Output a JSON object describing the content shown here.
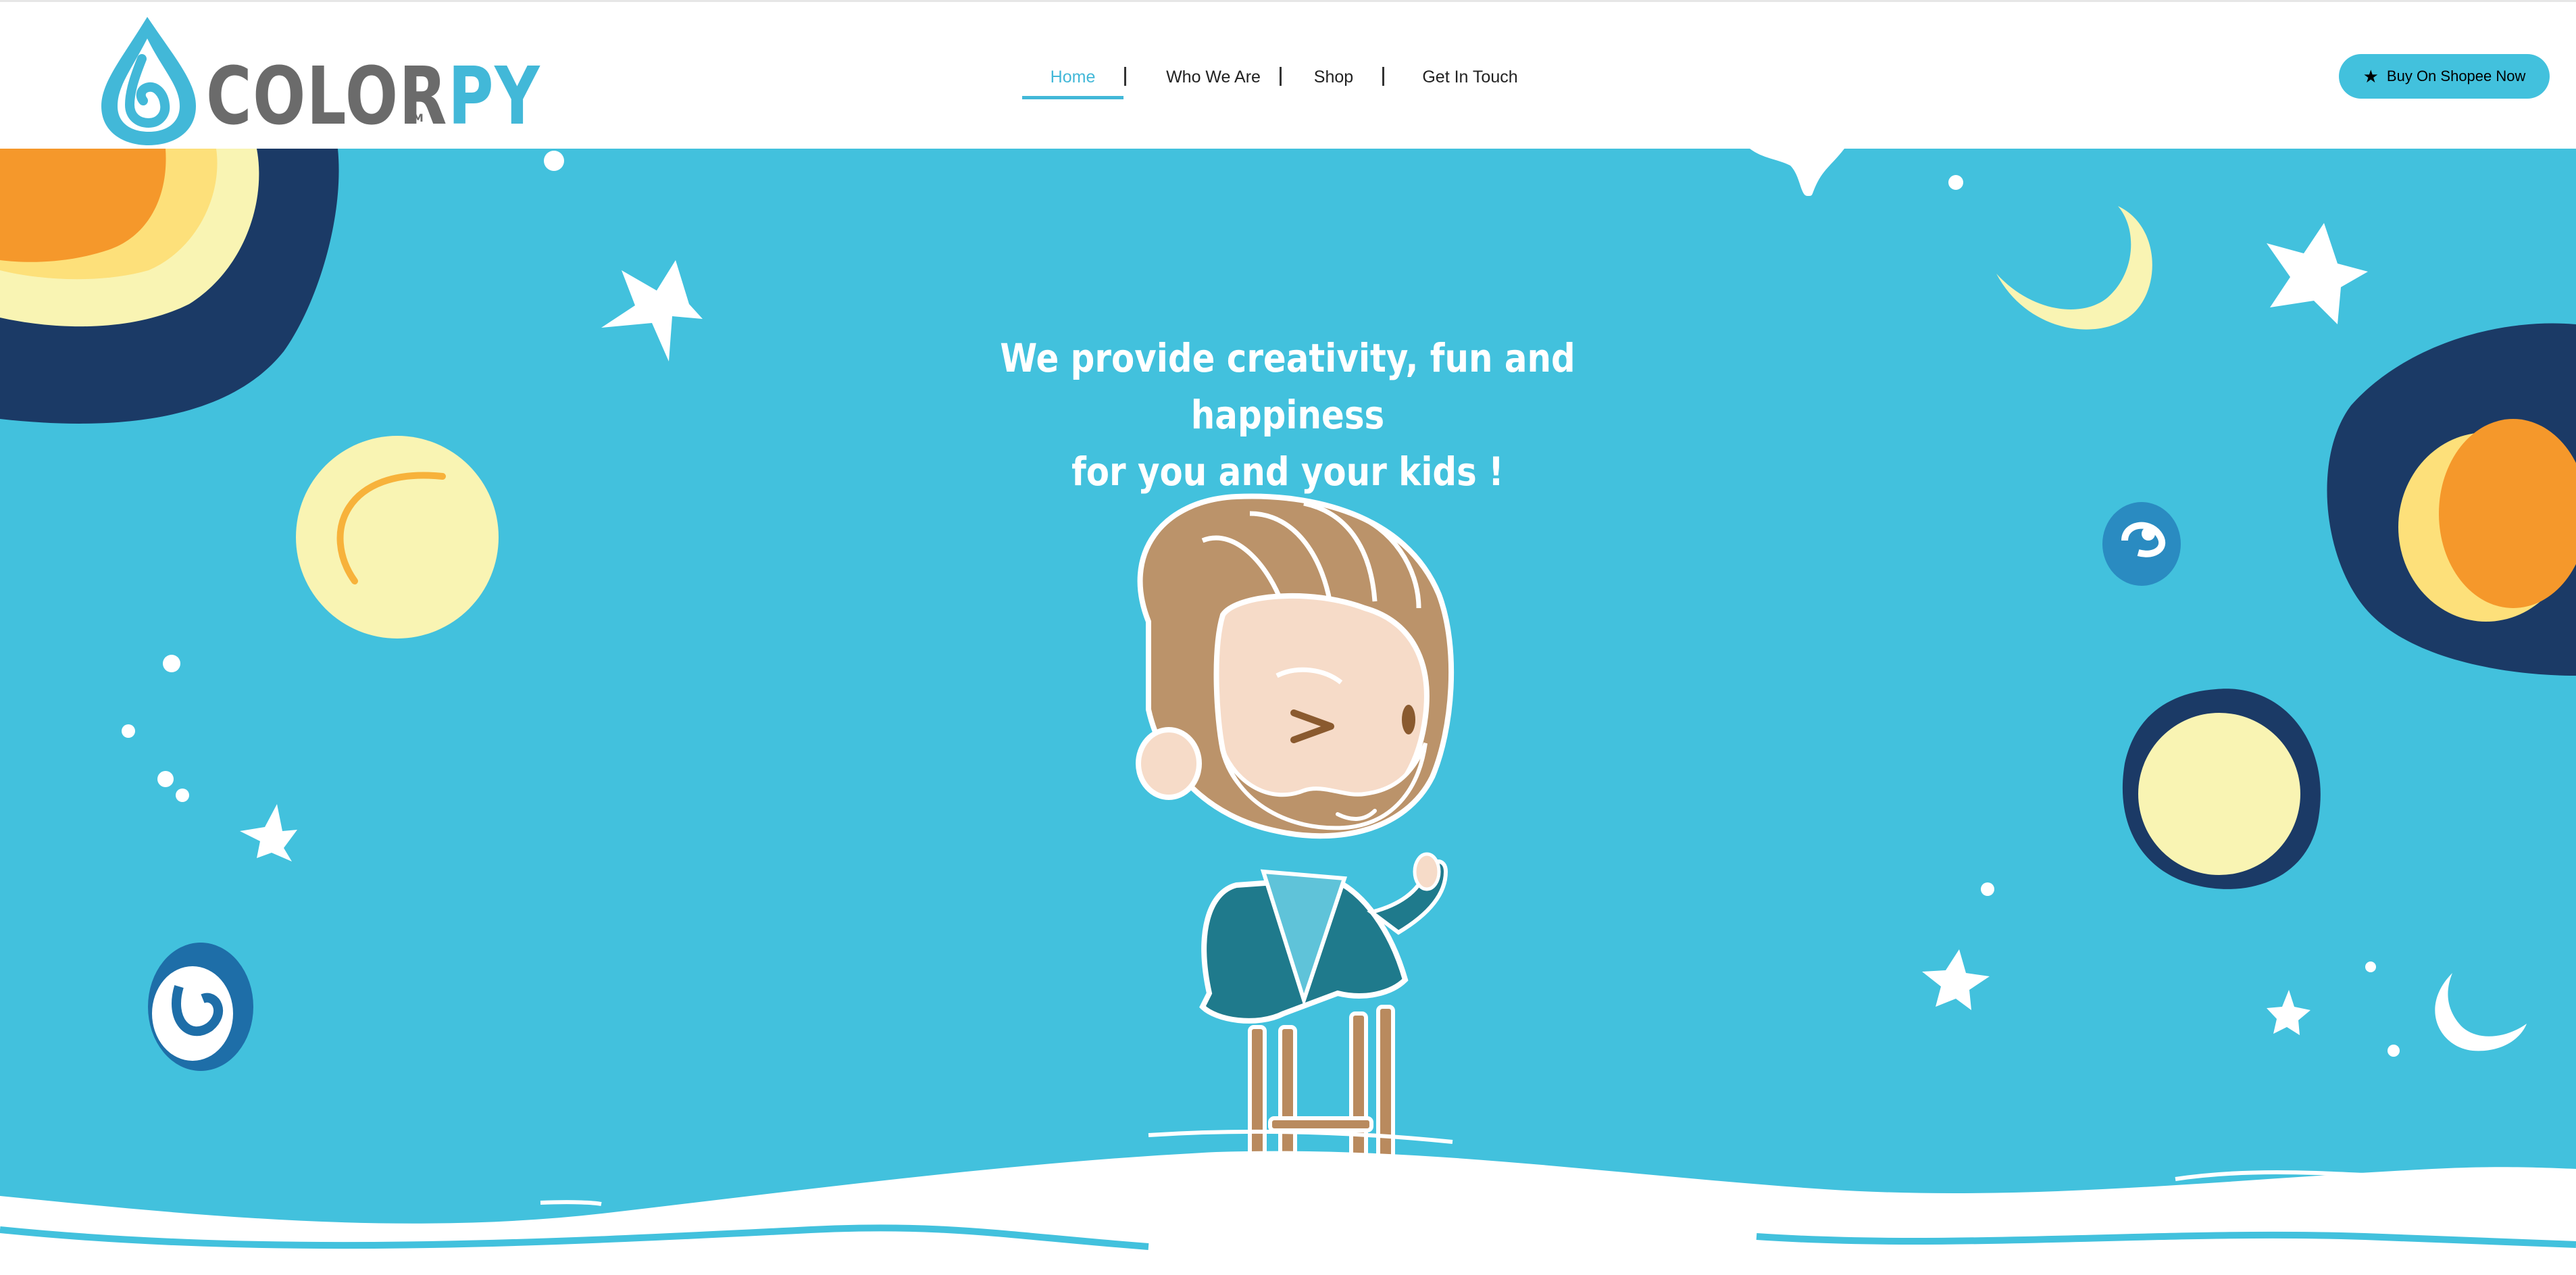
{
  "brand": {
    "name_part1": "COLOR",
    "name_part2": "PY",
    "trademark": "TM",
    "colors": {
      "primary": "#42c1dd",
      "logo_gray": "#6b6b6b",
      "dark_navy": "#1b3a66",
      "orange": "#f5982b",
      "pale_yellow": "#f9f4b3"
    }
  },
  "nav": {
    "items": [
      {
        "label": "Home",
        "active": true
      },
      {
        "label": "Who We Are",
        "active": false
      },
      {
        "label": "Shop",
        "active": false
      },
      {
        "label": "Get In Touch",
        "active": false
      }
    ]
  },
  "cta": {
    "label": "Buy On Shopee Now",
    "icon": "star-icon"
  },
  "hero": {
    "tagline_line1": "We provide creativity, fun and happiness",
    "tagline_line2": "for you and your kids !",
    "illustration": "cartoon-painter-on-stool",
    "decorations": [
      "sun-icon",
      "planet-icon",
      "moon-icon",
      "star-icon",
      "swirl-icon",
      "cloud-wave"
    ]
  }
}
